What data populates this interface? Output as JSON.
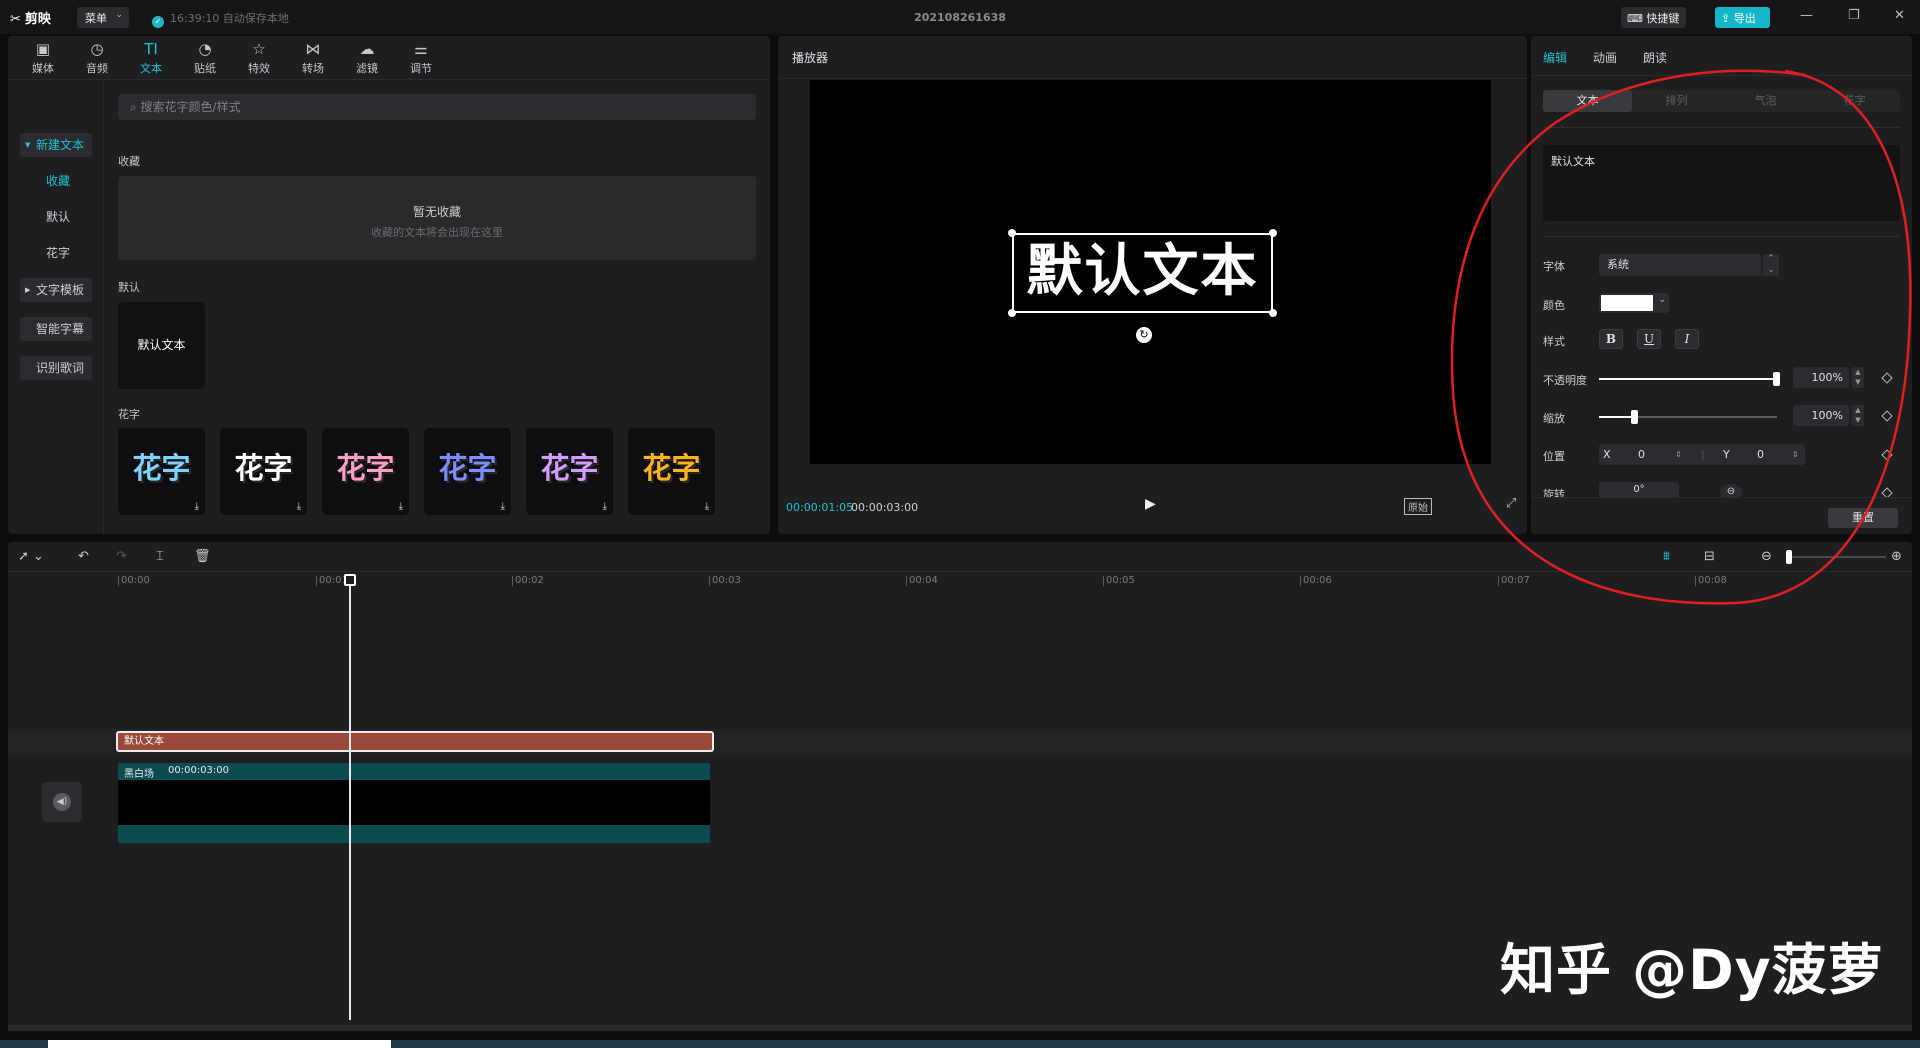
{
  "titlebar": {
    "app_name": "剪映",
    "menu_label": "菜单",
    "autosave_text": "16:39:10 自动保存本地",
    "project_name": "202108261638",
    "shortcut_label": "快捷键",
    "export_label": "导出"
  },
  "media_toolbar": [
    {
      "label": "媒体",
      "icon": "media-icon",
      "glyph": "▣"
    },
    {
      "label": "音频",
      "icon": "audio-icon",
      "glyph": "◷"
    },
    {
      "label": "文本",
      "icon": "text-icon",
      "glyph": "TI"
    },
    {
      "label": "贴纸",
      "icon": "sticker-icon",
      "glyph": "◔"
    },
    {
      "label": "特效",
      "icon": "effects-icon",
      "glyph": "☆"
    },
    {
      "label": "转场",
      "icon": "transition-icon",
      "glyph": "⋈"
    },
    {
      "label": "滤镜",
      "icon": "filter-icon",
      "glyph": "☁"
    },
    {
      "label": "调节",
      "icon": "adjust-icon",
      "glyph": "⚌"
    }
  ],
  "sidebar": {
    "new_text": "新建文本",
    "favorites": "收藏",
    "default": "默认",
    "flower_text": "花字",
    "text_template": "文字模板",
    "smart_caption": "智能字幕",
    "lyrics": "识别歌词"
  },
  "content": {
    "search_placeholder": "搜索花字颜色/样式",
    "favorites_title": "收藏",
    "empty_title": "暂无收藏",
    "empty_hint": "收藏的文本将会出现在这里",
    "default_title": "默认",
    "default_tile": "默认文本",
    "flower_title": "花字",
    "flower_tile_text": "花字",
    "flower_colors": [
      "#7fd3ff",
      "#ffffff",
      "#ff9ec7",
      "#7d8cff",
      "#d59cff",
      "#ffb21c"
    ]
  },
  "player": {
    "title": "播放器",
    "overlay_text": "默认文本",
    "current_time": "00:00:01:05",
    "total_time": "00:00:03:00",
    "ratio_label": "原始"
  },
  "properties": {
    "tabs": [
      "编辑",
      "动画",
      "朗读"
    ],
    "sub_tabs": [
      "文本",
      "排列",
      "气泡",
      "花字"
    ],
    "text_value": "默认文本",
    "font_label": "字体",
    "font_value": "系统",
    "color_label": "颜色",
    "color_value": "#ffffff",
    "style_label": "样式",
    "style_bold": "B",
    "style_underline": "U",
    "style_italic": "I",
    "opacity_label": "不透明度",
    "opacity_value": "100%",
    "opacity_level": 1.0,
    "scale_label": "缩放",
    "scale_value": "100%",
    "scale_level": 0.2,
    "position_label": "位置",
    "pos_x_label": "X",
    "pos_x_value": "0",
    "pos_y_label": "Y",
    "pos_y_value": "0",
    "rotation_label": "旋转",
    "rotation_value": "0°",
    "reset_label": "重置"
  },
  "timeline": {
    "ruler": [
      "00:00",
      "00:01",
      "00:02",
      "00:03",
      "00:04",
      "00:05",
      "00:06",
      "00:07",
      "00:08"
    ],
    "text_clip_label": "默认文本",
    "video_clip_label": "黑白场",
    "video_clip_duration": "00:00:03:00"
  },
  "watermark": "知乎 @Dy菠萝",
  "colors": {
    "accent": "#1fc3d6",
    "text_clip": "#9b4a3a",
    "video_clip": "#0c4b4e",
    "annotation": "#e02020"
  }
}
